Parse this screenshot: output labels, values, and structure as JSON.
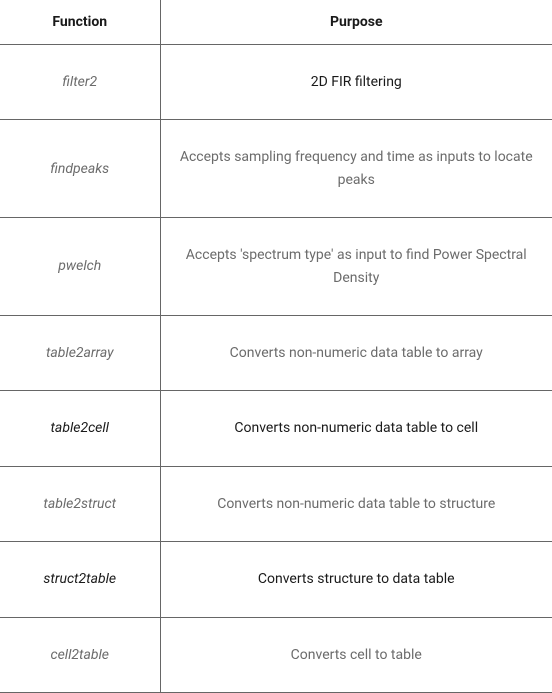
{
  "headers": {
    "function": "Function",
    "purpose": "Purpose"
  },
  "rows": [
    {
      "function": "filter2",
      "purpose": "2D FIR filtering",
      "funcDark": false,
      "purpDark": true
    },
    {
      "function": "findpeaks",
      "purpose": "Accepts sampling frequency and time as inputs to locate peaks",
      "funcDark": false,
      "purpDark": false
    },
    {
      "function": "pwelch",
      "purpose": "Accepts 'spectrum type' as input to find Power Spectral Density",
      "funcDark": false,
      "purpDark": false
    },
    {
      "function": "table2array",
      "purpose": "Converts non-numeric data table to array",
      "funcDark": false,
      "purpDark": false
    },
    {
      "function": "table2cell",
      "purpose": "Converts non-numeric data table to cell",
      "funcDark": true,
      "purpDark": true
    },
    {
      "function": "table2struct",
      "purpose": "Converts non-numeric data table to structure",
      "funcDark": false,
      "purpDark": false
    },
    {
      "function": "struct2table",
      "purpose": "Converts structure to data table",
      "funcDark": true,
      "purpDark": true
    },
    {
      "function": "cell2table",
      "purpose": "Converts cell to table",
      "funcDark": false,
      "purpDark": false
    }
  ]
}
